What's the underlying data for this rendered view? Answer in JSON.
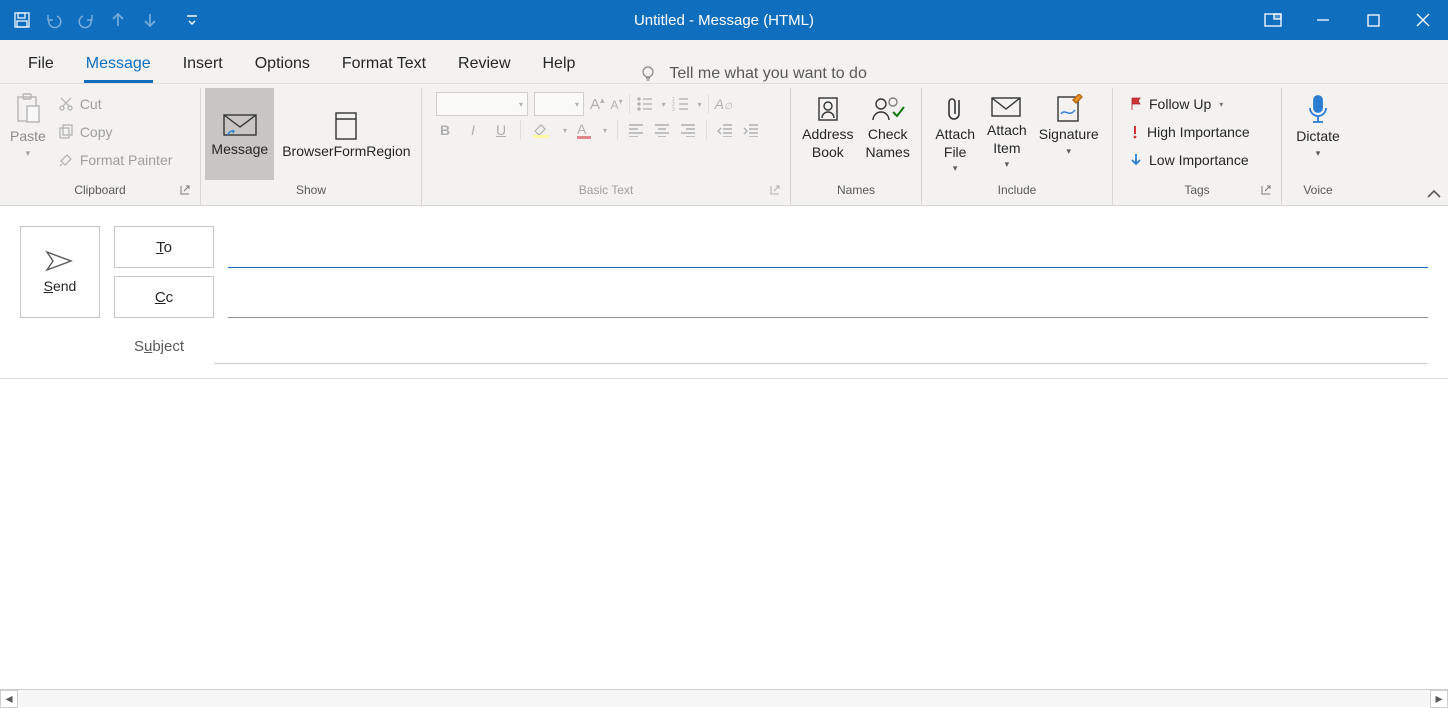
{
  "window": {
    "title": "Untitled  -  Message (HTML)"
  },
  "ribbon": {
    "tabs": {
      "file": "File",
      "message": "Message",
      "insert": "Insert",
      "options": "Options",
      "formatText": "Format Text",
      "review": "Review",
      "help": "Help"
    },
    "active": "message",
    "tellMe": "Tell me what you want to do"
  },
  "groups": {
    "clipboard": {
      "label": "Clipboard",
      "paste": "Paste",
      "cut": "Cut",
      "copy": "Copy",
      "formatPainter": "Format Painter"
    },
    "show": {
      "label": "Show",
      "message": "Message",
      "browserFormRegion": "BrowserFormRegion"
    },
    "basicText": {
      "label": "Basic Text"
    },
    "names": {
      "label": "Names",
      "addressBook": "Address\nBook",
      "checkNames": "Check\nNames"
    },
    "include": {
      "label": "Include",
      "attachFile": "Attach\nFile",
      "attachItem": "Attach\nItem",
      "signature": "Signature"
    },
    "tags": {
      "label": "Tags",
      "followUp": "Follow Up",
      "highImportance": "High Importance",
      "lowImportance": "Low Importance"
    },
    "voice": {
      "label": "Voice",
      "dictate": "Dictate"
    }
  },
  "compose": {
    "send": "Send",
    "to": "To",
    "cc": "Cc",
    "subjectLabel": "Subject",
    "toValue": "",
    "ccValue": "",
    "subjectValue": ""
  }
}
